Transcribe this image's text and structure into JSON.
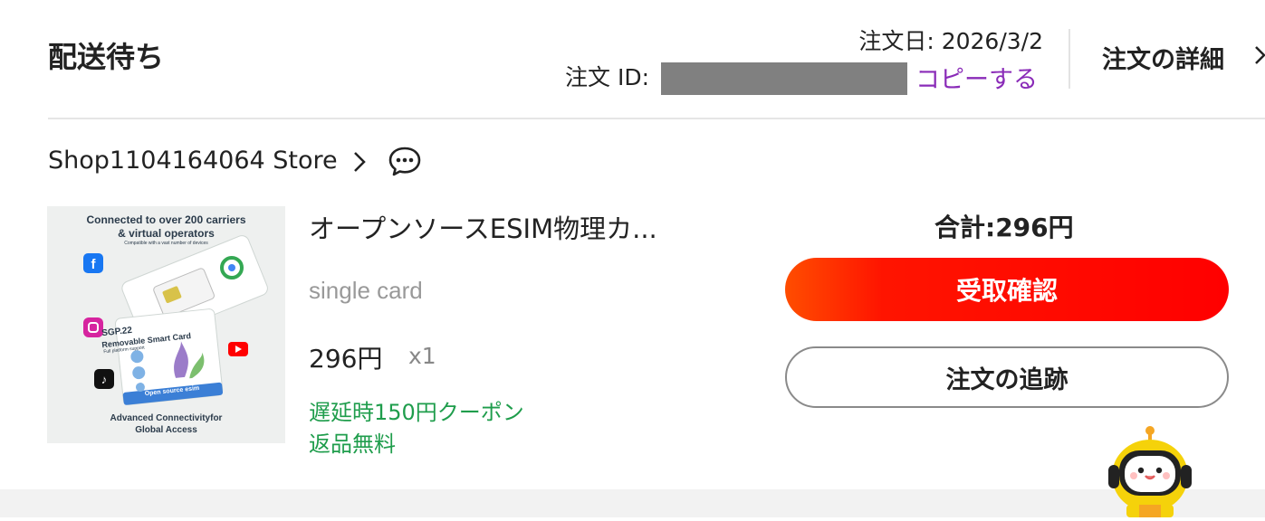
{
  "header": {
    "status": "配送待ち",
    "order_date": "注文日: 2026/3/2",
    "order_id_label": "注文 ID:",
    "copy_label": "コピーする",
    "details_label": "注文の詳細"
  },
  "store": {
    "name": "Shop1104164064 Store"
  },
  "product": {
    "title": "オープンソースESIM物理カ...",
    "variant": "single card",
    "price": "296円",
    "quantity": "x1",
    "promo_coupon": "遅延時150円クーポン",
    "promo_return": "返品無料",
    "image_text": {
      "headline": "Connected to over 200 carriers",
      "headline2": "& virtual operators",
      "sub": "Compatible with a vast number of devices",
      "card_title": "SGP.22",
      "card_subtitle": "Removable Smart Card",
      "card_note": "Full platform support",
      "card_banner": "Open source esim",
      "footer1": "Advanced Connectivityfor",
      "footer2": "Global Access"
    }
  },
  "summary": {
    "total": "合計:296円",
    "confirm_button": "受取確認",
    "track_button": "注文の追跡"
  },
  "colors": {
    "accent_red": "#ff0000",
    "copy_purple": "#8a2bb8",
    "promo_green": "#1f9d4c"
  },
  "icons": [
    "chevron-right-icon",
    "chat-bubble-icon",
    "mascot-robot-icon"
  ]
}
